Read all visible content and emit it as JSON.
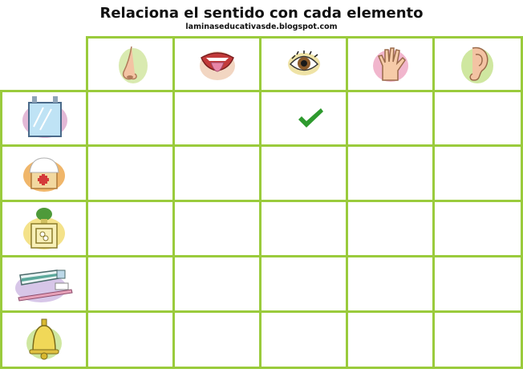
{
  "worksheet": {
    "title": "Relaciona el sentido con cada elemento",
    "subtitle": "laminaseducativasde.blogspot.com"
  },
  "columns": [
    {
      "icon": "nose-icon"
    },
    {
      "icon": "mouth-tongue-icon"
    },
    {
      "icon": "eye-icon"
    },
    {
      "icon": "hand-icon"
    },
    {
      "icon": "ear-icon"
    }
  ],
  "rows": [
    {
      "icon": "mirror-icon",
      "checked_column": "eye-icon"
    },
    {
      "icon": "cake-icon",
      "checked_column": ""
    },
    {
      "icon": "perfume-bottle-icon",
      "checked_column": ""
    },
    {
      "icon": "toothpaste-toothbrush-icon",
      "checked_column": ""
    },
    {
      "icon": "bell-icon",
      "checked_column": ""
    }
  ],
  "colors": {
    "grid": "#9acb3c",
    "checkmark": "#2e9a2e"
  }
}
